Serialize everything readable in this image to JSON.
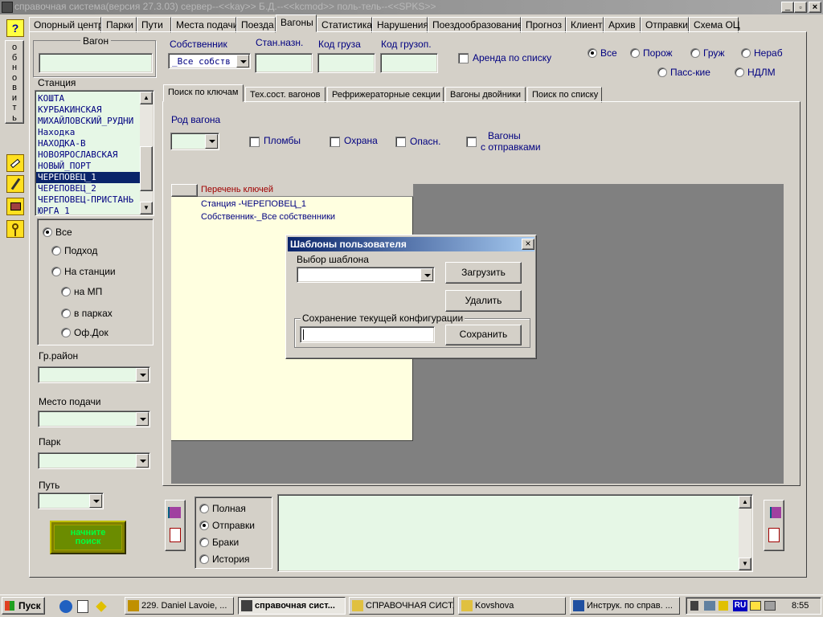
{
  "window": {
    "title": "справочная система(версия 27.3.03) сервер--<<kay>> Б.Д.--<<kcmod>> поль-тель--<<SPKS>>"
  },
  "menu_tabs": [
    "Опорный центр",
    "Парки",
    "Пути",
    "Места подачи",
    "Поезда",
    "Вагоны",
    "Статистика",
    "Нарушения",
    "Поездообразование",
    "Прогноз",
    "Клиент",
    "Архив",
    "Отправки",
    "Схема ОЦ"
  ],
  "left_toolbar": {
    "help": "?",
    "refresh_letters": [
      "о",
      "б",
      "н",
      "о",
      "в",
      "и",
      "т",
      "ь"
    ]
  },
  "left_panel": {
    "wagon_label": "Вагон",
    "wagon_value": "",
    "station_label": "Станция",
    "stations": [
      "КОШТА",
      "КУРБАКИНСКАЯ",
      "МИХАЙЛОВСКИЙ_РУДНИ",
      "Находка",
      "НАХОДКА-В",
      "НОВОЯРОСЛАВСКАЯ",
      "НОВЫЙ_ПОРТ",
      "ЧЕРЕПОВЕЦ_1",
      "ЧЕРЕПОВЕЦ_2",
      "ЧЕРЕПОВЕЦ-ПРИСТАНЬ",
      "ЮРГА_1"
    ],
    "selected_station_index": 7,
    "location_options": [
      "Все",
      "Подход",
      "На станции",
      "на МП",
      "в парках",
      "Оф.Док"
    ],
    "gr_rayon_label": "Гр.район",
    "mesto_label": "Место подачи",
    "park_label": "Парк",
    "put_label": "Путь",
    "search_button": "начните поиск"
  },
  "top_filters": {
    "owner_label": "Собственник",
    "owner_value": "_Все собств",
    "stan_label": "Стан.назн.",
    "cargo_label": "Код груза",
    "cargo_zop_label": "Код грузоп.",
    "arenda_label": "Аренда по списку",
    "type_radios": [
      "Все",
      "Порож",
      "Груж",
      "Нераб",
      "Пасс-кие",
      "НДЛМ"
    ]
  },
  "sub_tabs": [
    "Поиск по ключам",
    "Тех.сост. вагонов",
    "Рефрижераторные секции",
    "Вагоны двойники",
    "Поиск по списку"
  ],
  "key_search": {
    "rod_label": "Род вагона",
    "checkboxes": [
      "Пломбы",
      "Охрана",
      "Опасн."
    ],
    "vagony_label_1": "Вагоны",
    "vagony_label_2": "с отправками"
  },
  "keys_panel": {
    "header": "Перечень ключей",
    "items": [
      "Станция -ЧЕРЕПОВЕЦ_1",
      "Собственник-_Все собственники"
    ]
  },
  "dialog": {
    "title": "Шаблоны пользователя",
    "choose_label": "Выбор шаблона",
    "load_button": "Загрузить",
    "delete_button": "Удалить",
    "save_group": "Сохранение текущей конфигурации",
    "save_button": "Сохранить"
  },
  "bottom_radios": [
    "Полная",
    "Отправки",
    "Браки",
    "История"
  ],
  "taskbar": {
    "start": "Пуск",
    "tasks": [
      "229. Daniel Lavoie, ...",
      "справочная сист...",
      "СПРАВОЧНАЯ СИСТ...",
      "Kovshova",
      "Инструк. по справ. ..."
    ],
    "lang": "RU",
    "clock": "8:55"
  }
}
